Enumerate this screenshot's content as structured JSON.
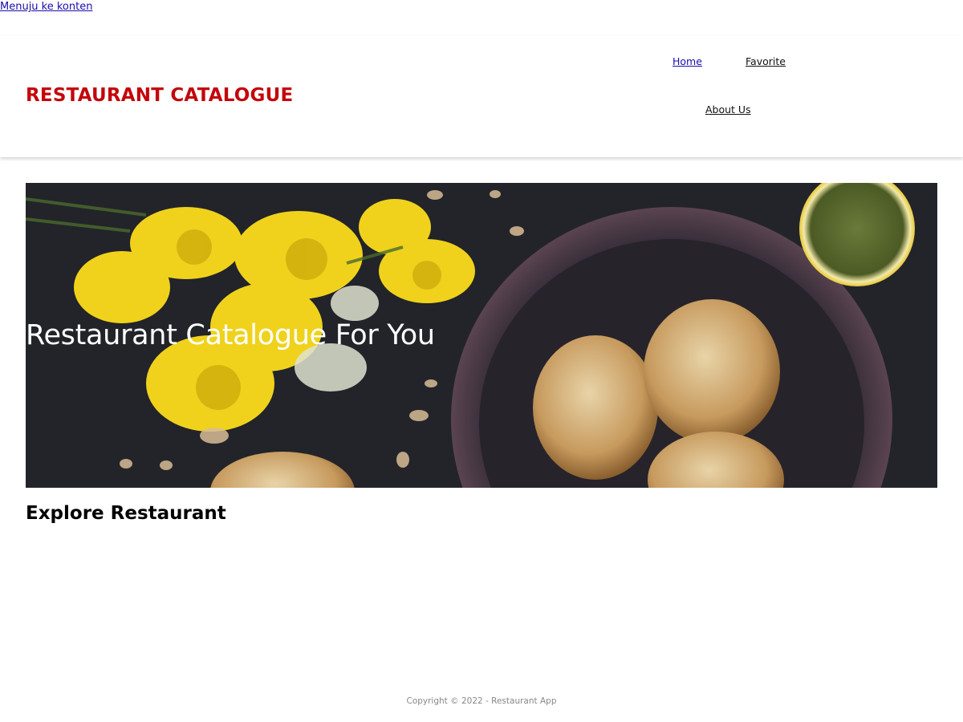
{
  "skip_link": {
    "label": "Menuju ke konten"
  },
  "header": {
    "brand": "RESTAURANT CATALOGUE",
    "nav": [
      {
        "label": "Home"
      },
      {
        "label": "Favorite"
      },
      {
        "label": "About Us"
      }
    ]
  },
  "hero": {
    "title": "Restaurant Catalogue For You"
  },
  "main": {
    "section_title": "Explore Restaurant"
  },
  "footer": {
    "copyright": "Copyright © 2022 - Restaurant App"
  },
  "colors": {
    "brand": "#c4060a",
    "link": "#1a0dab",
    "hero_bg": "#1f2126"
  }
}
